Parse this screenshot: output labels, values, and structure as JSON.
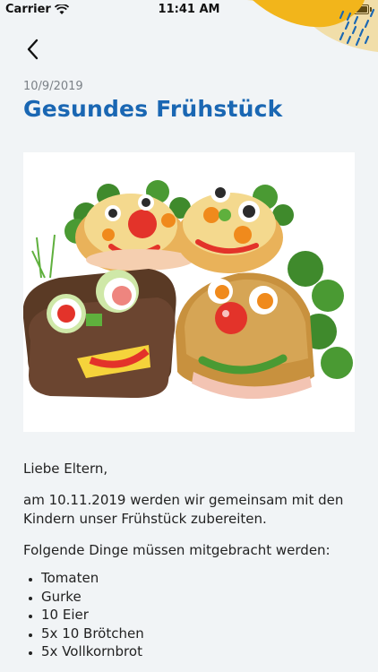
{
  "status_bar": {
    "carrier": "Carrier",
    "time": "11:41 AM"
  },
  "header": {
    "back_icon": "chevron-left-icon"
  },
  "post": {
    "date": "10/9/2019",
    "title": "Gesundes Frühstück",
    "image_alt": "Belegte Brötchen mit Gesichtern aus Gemüse",
    "paragraphs": [
      "Liebe Eltern,",
      "am 10.11.2019 werden wir gemeinsam mit den Kindern unser Frühstück zubereiten.",
      "Folgende Dinge müssen mitgebracht werden:"
    ],
    "items": [
      "Tomaten",
      "Gurke",
      "10 Eier",
      "5x 10 Brötchen",
      "5x Vollkornbrot"
    ]
  },
  "colors": {
    "background": "#f1f4f6",
    "title": "#1a67b3",
    "date": "#7b8187",
    "deco_yellow": "#f2b51b",
    "deco_blue": "#1a67b3"
  }
}
